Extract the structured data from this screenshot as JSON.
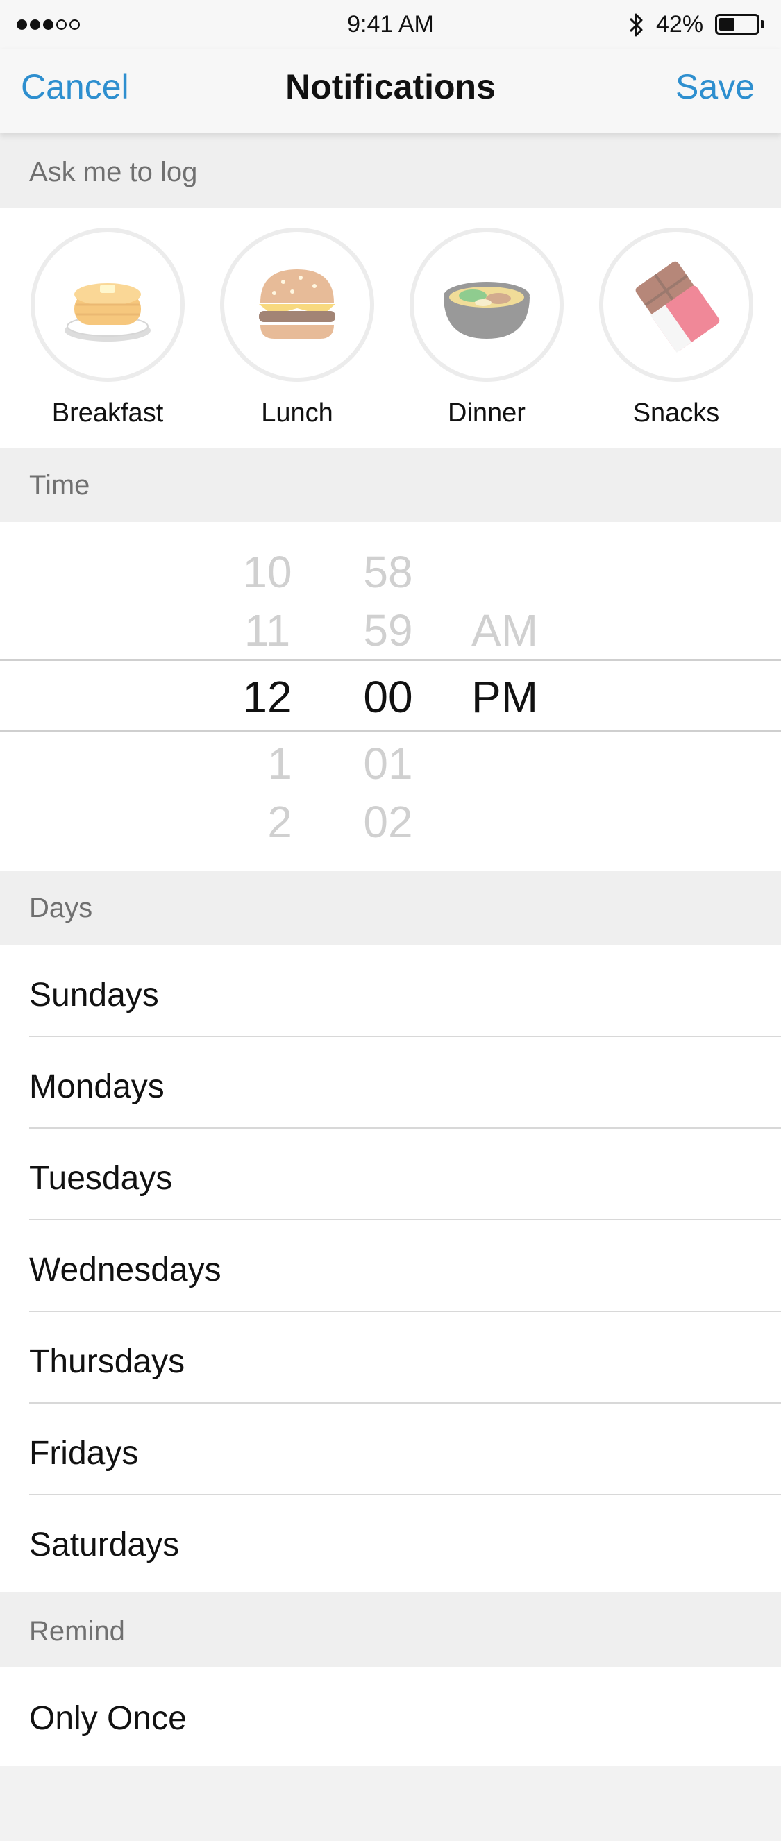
{
  "status_bar": {
    "time": "9:41 AM",
    "battery": "42%",
    "battery_level": 0.42,
    "signal_bars": 3,
    "signal_total": 5
  },
  "nav": {
    "cancel": "Cancel",
    "title": "Notifications",
    "save": "Save"
  },
  "sections": {
    "ask": "Ask me to log",
    "time": "Time",
    "days": "Days",
    "remind": "Remind"
  },
  "meals": [
    {
      "label": "Breakfast",
      "icon": "pancakes-icon"
    },
    {
      "label": "Lunch",
      "icon": "burger-icon"
    },
    {
      "label": "Dinner",
      "icon": "soup-bowl-icon"
    },
    {
      "label": "Snacks",
      "icon": "chocolate-bar-icon"
    }
  ],
  "time_picker": {
    "hours": [
      "10",
      "11",
      "12",
      "1",
      "2"
    ],
    "minutes": [
      "58",
      "59",
      "00",
      "01",
      "02"
    ],
    "periods": [
      "AM",
      "PM"
    ],
    "selected": {
      "hour": "12",
      "minute": "00",
      "period": "PM"
    }
  },
  "days": [
    "Sundays",
    "Mondays",
    "Tuesdays",
    "Wednesdays",
    "Thursdays",
    "Fridays",
    "Saturdays"
  ],
  "remind": {
    "value": "Only Once"
  },
  "colors": {
    "accent": "#2e8fcf",
    "section_bg": "#efefef",
    "picker_dim": "#d0d0d0"
  }
}
